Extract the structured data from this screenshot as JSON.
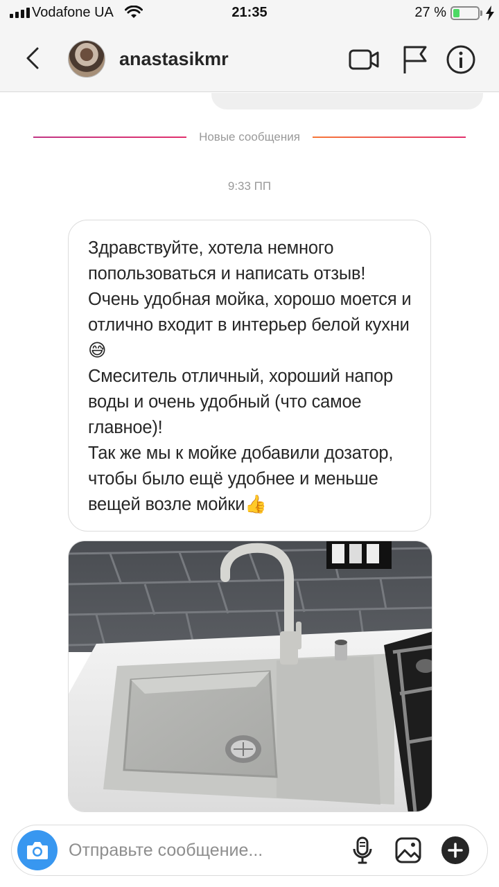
{
  "status_bar": {
    "carrier": "Vodafone UA",
    "time": "21:35",
    "battery_percent_label": "27 %",
    "battery_level": 0.27
  },
  "header": {
    "username": "anastasikmr",
    "icons": [
      "back-chevron-icon",
      "avatar",
      "video-camera-icon",
      "flag-icon",
      "info-icon"
    ]
  },
  "chat": {
    "new_messages_divider": "Новые сообщения",
    "timestamp": "9:33 ПП",
    "message_paragraphs": [
      "Здравствуйте, хотела немного попользоваться и написать отзыв!",
      "Очень удобная мойка, хорошо моется и отлично входит в интерьер белой кухни😅",
      "Смеситель отличный, хороший напор воды и очень удобный (что самое главное)!",
      "Так же мы к мойке добавили дозатор, чтобы было ещё удобнее и меньше вещей возле мойки👍"
    ]
  },
  "composer": {
    "placeholder": "Отправьте сообщение...",
    "icons": [
      "camera-icon",
      "microphone-icon",
      "gallery-icon",
      "add-icon"
    ]
  },
  "colors": {
    "accent_blue": "#3897f0",
    "divider_gradient_start": "#c13584",
    "divider_gradient_end": "#f77737",
    "battery_green": "#4cd964"
  }
}
